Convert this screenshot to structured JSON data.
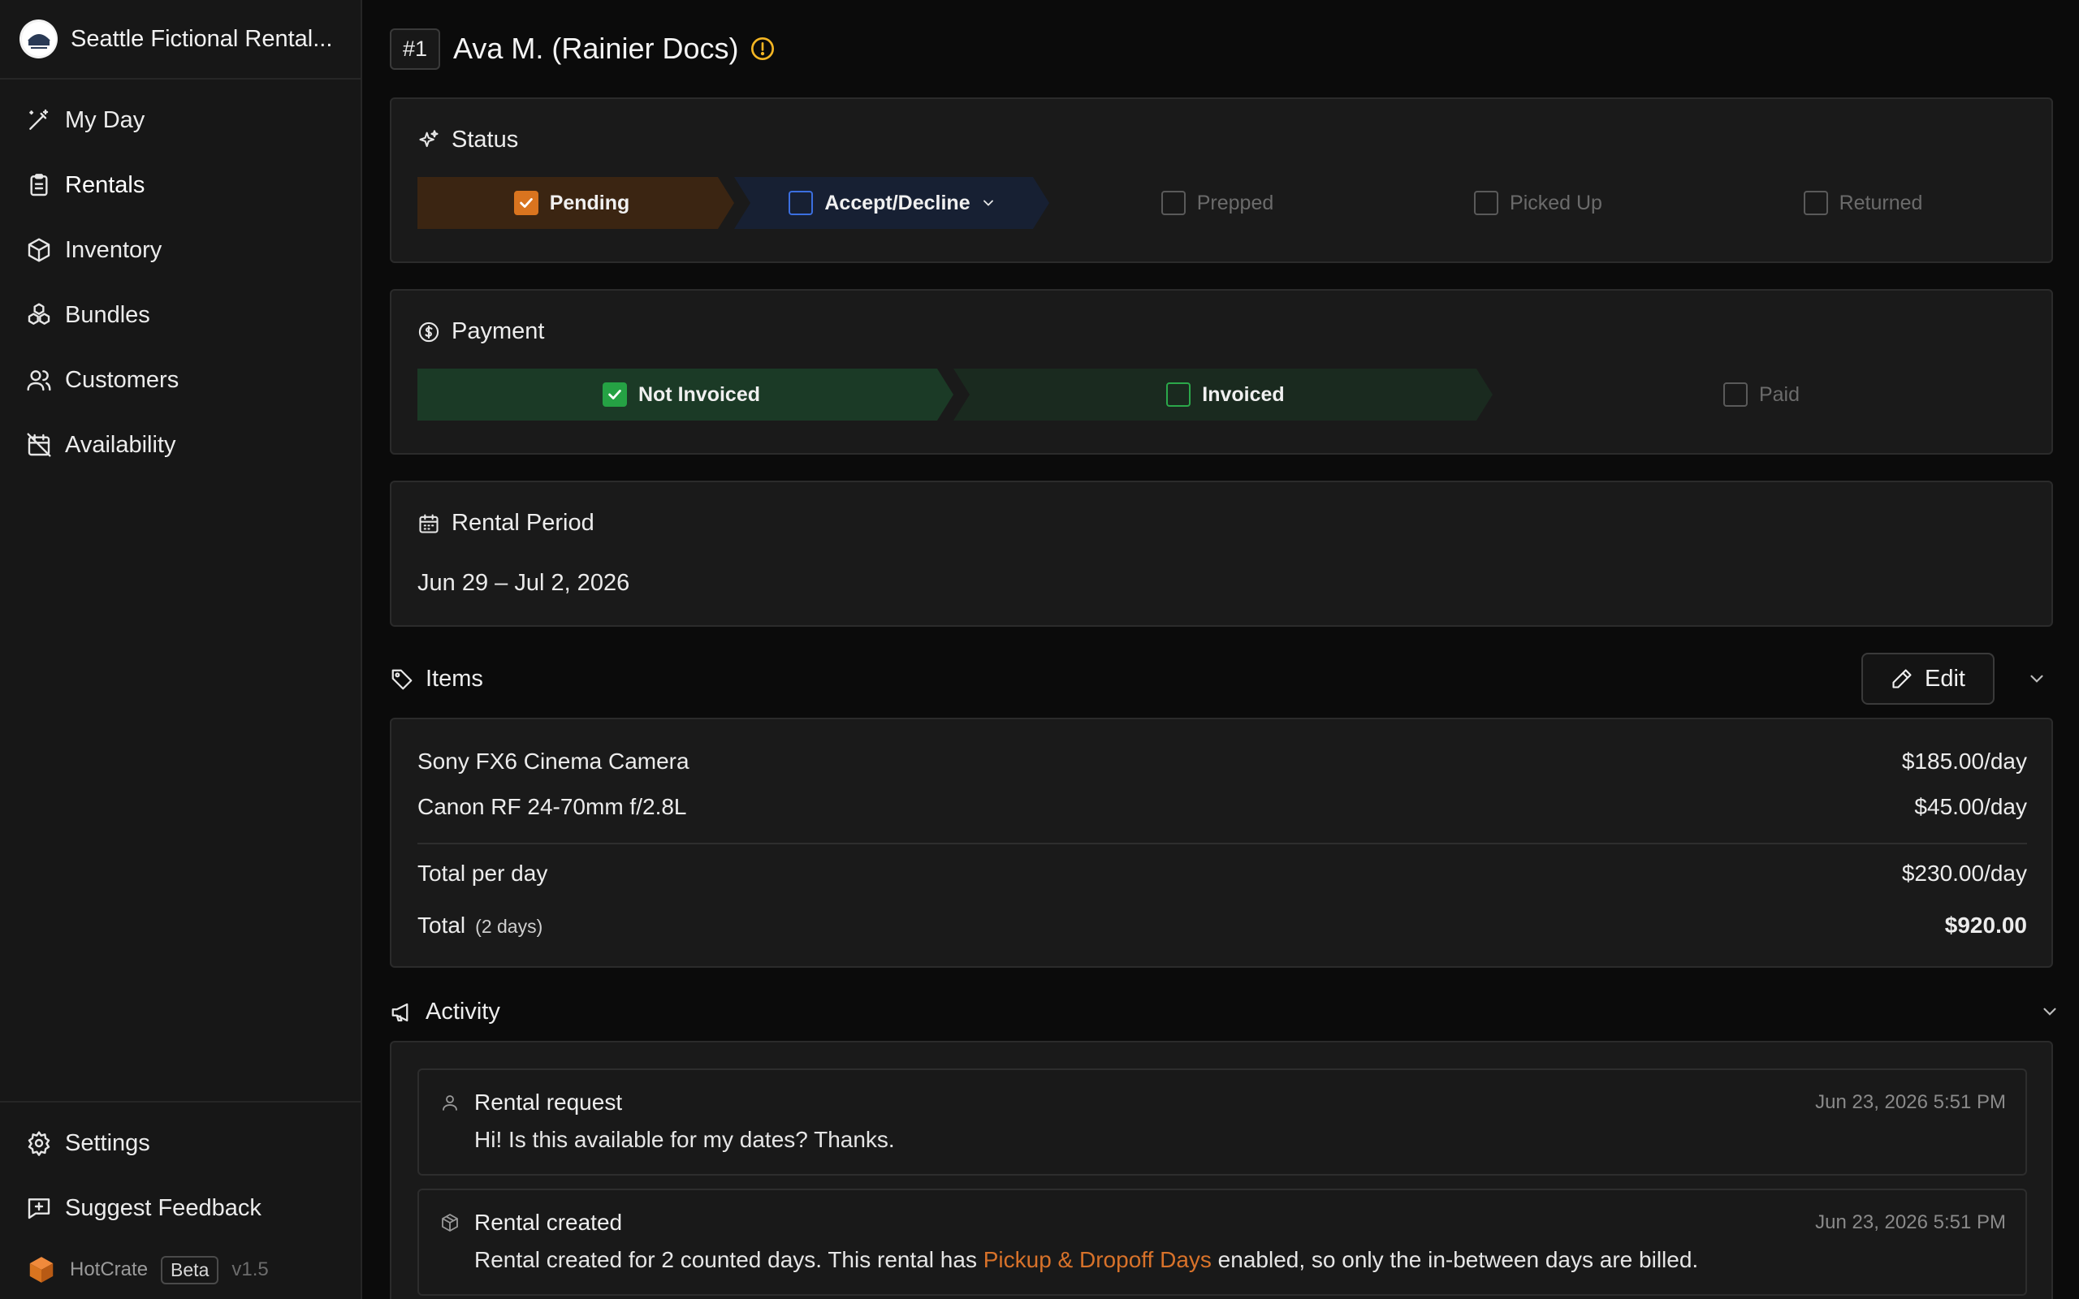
{
  "sidebar": {
    "org_name": "Seattle Fictional Rental...",
    "items": [
      {
        "label": "My Day",
        "icon": "wand-icon"
      },
      {
        "label": "Rentals",
        "icon": "clipboard-icon"
      },
      {
        "label": "Inventory",
        "icon": "box-icon"
      },
      {
        "label": "Bundles",
        "icon": "bundles-icon"
      },
      {
        "label": "Customers",
        "icon": "users-icon"
      },
      {
        "label": "Availability",
        "icon": "calendar-off-icon"
      }
    ],
    "bottom": {
      "settings": "Settings",
      "feedback": "Suggest Feedback",
      "brand": "HotCrate",
      "beta": "Beta",
      "version": "v1.5"
    }
  },
  "header": {
    "number": "#1",
    "title": "Ava M. (Rainier Docs)"
  },
  "status": {
    "title": "Status",
    "steps": [
      "Pending",
      "Accept/Decline",
      "Prepped",
      "Picked Up",
      "Returned"
    ]
  },
  "payment": {
    "title": "Payment",
    "steps": [
      "Not Invoiced",
      "Invoiced",
      "Paid"
    ]
  },
  "period": {
    "title": "Rental Period",
    "value": "Jun 29 – Jul 2, 2026"
  },
  "items": {
    "title": "Items",
    "edit_label": "Edit",
    "lines": [
      {
        "name": "Sony FX6 Cinema Camera",
        "price": "$185.00/day"
      },
      {
        "name": "Canon RF 24-70mm f/2.8L",
        "price": "$45.00/day"
      }
    ],
    "total_per_day_label": "Total per day",
    "total_per_day": "$230.00/day",
    "total_label": "Total",
    "total_days": "(2 days)",
    "total": "$920.00"
  },
  "activity": {
    "title": "Activity",
    "entries": [
      {
        "title": "Rental request",
        "time": "Jun 23, 2026 5:51 PM",
        "body": "Hi! Is this available for my dates? Thanks."
      },
      {
        "title": "Rental created",
        "time": "Jun 23, 2026 5:51 PM",
        "body_pre": "Rental created for 2 counted days. This rental has ",
        "body_link": "Pickup & Dropoff Days",
        "body_post": " enabled, so only the in-between days are billed."
      }
    ]
  },
  "colors": {
    "accent_orange": "#d9741f",
    "accent_green": "#25a244",
    "accent_blue": "#3b6fe0",
    "link": "#d8722a"
  }
}
